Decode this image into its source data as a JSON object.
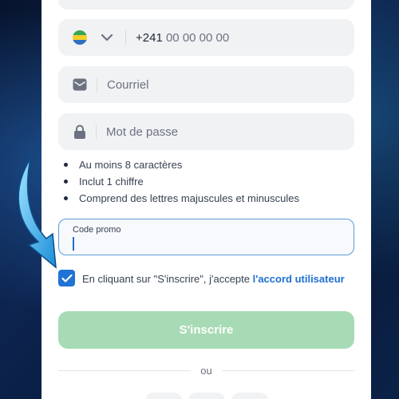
{
  "phone": {
    "country_icon": "gabon-flag-icon",
    "country_code": "+241",
    "placeholder": "00 00 00 00"
  },
  "email": {
    "placeholder": "Courriel"
  },
  "password": {
    "placeholder": "Mot de passe"
  },
  "requirements": [
    "Au moins 8 caractères",
    "Inclut 1 chiffre",
    "Comprend des lettres majuscules et minuscules"
  ],
  "promo": {
    "label": "Code promo",
    "value": ""
  },
  "consent": {
    "checked": true,
    "text": "En cliquant sur \"S'inscrire\", j'accepte ",
    "link_text": "l'accord utilisateur"
  },
  "submit_label": "S'inscrire",
  "or_text": "ou",
  "colors": {
    "accent": "#1f73d4",
    "submit_disabled": "#a7dbb5",
    "field_bg": "#f1f2f4"
  }
}
